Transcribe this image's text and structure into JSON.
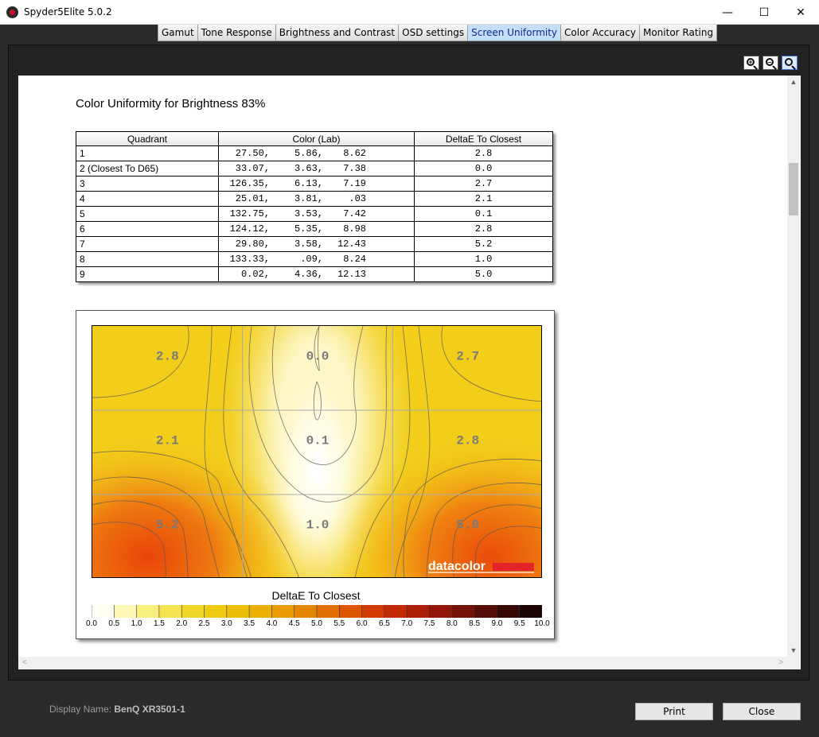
{
  "window": {
    "title": "Spyder5Elite 5.0.2"
  },
  "tabs": [
    {
      "label": "Gamut"
    },
    {
      "label": "Tone Response"
    },
    {
      "label": "Brightness and Contrast"
    },
    {
      "label": "OSD settings"
    },
    {
      "label": "Screen Uniformity",
      "active": true
    },
    {
      "label": "Color Accuracy"
    },
    {
      "label": "Monitor Rating"
    }
  ],
  "zoom_tools": [
    {
      "icon": "zoom-in-icon"
    },
    {
      "icon": "zoom-out-icon"
    },
    {
      "icon": "zoom-fit-icon",
      "active": true
    }
  ],
  "report": {
    "title": "Color Uniformity for Brightness 83%",
    "table": {
      "headers": [
        "Quadrant",
        "Color (Lab)",
        "DeltaE To Closest"
      ],
      "rows": [
        {
          "quadrant": "1",
          "l": "27.50,",
          "a": "5.86,",
          "b": "8.62",
          "delta": "2.8"
        },
        {
          "quadrant": "2 (Closest To D65)",
          "l": "33.07,",
          "a": "3.63,",
          "b": "7.38",
          "delta": "0.0"
        },
        {
          "quadrant": "3",
          "l": "126.35,",
          "a": "6.13,",
          "b": "7.19",
          "delta": "2.7"
        },
        {
          "quadrant": "4",
          "l": "25.01,",
          "a": "3.81,",
          "b": ".03",
          "delta": "2.1"
        },
        {
          "quadrant": "5",
          "l": "132.75,",
          "a": "3.53,",
          "b": "7.42",
          "delta": "0.1"
        },
        {
          "quadrant": "6",
          "l": "124.12,",
          "a": "5.35,",
          "b": "8.98",
          "delta": "2.8"
        },
        {
          "quadrant": "7",
          "l": "29.80,",
          "a": "3.58,",
          "b": "12.43",
          "delta": "5.2"
        },
        {
          "quadrant": "8",
          "l": "133.33,",
          "a": ".09,",
          "b": "8.24",
          "delta": "1.0"
        },
        {
          "quadrant": "9",
          "l": "0.02,",
          "a": "4.36,",
          "b": "12.13",
          "delta": "5.0"
        }
      ]
    }
  },
  "chart_data": {
    "type": "heatmap",
    "title": "DeltaE To Closest",
    "grid": {
      "rows": 3,
      "cols": 3
    },
    "values": [
      [
        2.8,
        0.0,
        2.7
      ],
      [
        2.1,
        0.1,
        2.8
      ],
      [
        5.2,
        1.0,
        5.0
      ]
    ],
    "cell_labels": [
      [
        "2.8",
        "0.0",
        "2.7"
      ],
      [
        "2.1",
        "0.1",
        "2.8"
      ],
      [
        "5.2",
        "1.0",
        "5.0"
      ]
    ],
    "scale_range": [
      0,
      10
    ],
    "scale_ticks": [
      "0.0",
      "0.5",
      "1.0",
      "1.5",
      "2.0",
      "2.5",
      "3.0",
      "3.5",
      "4.0",
      "4.5",
      "5.0",
      "5.5",
      "6.0",
      "6.5",
      "7.0",
      "7.5",
      "8.0",
      "8.5",
      "9.0",
      "9.5",
      "10.0"
    ],
    "scale_colors": [
      "#fffef2",
      "#fdf7b6",
      "#f9ef7e",
      "#f5e350",
      "#f1d627",
      "#efca12",
      "#eebf08",
      "#ecb005",
      "#e99c03",
      "#e58603",
      "#e26f03",
      "#dd5503",
      "#d23c04",
      "#c22a05",
      "#ad1e08",
      "#921709",
      "#741208",
      "#560d06",
      "#380804",
      "#1c0402"
    ],
    "watermark": "datacolor",
    "accent_color": "#e3242b"
  },
  "footer": {
    "display_label": "Display Name:",
    "display_value": "BenQ XR3501-1",
    "print_label": "Print",
    "close_label": "Close"
  }
}
